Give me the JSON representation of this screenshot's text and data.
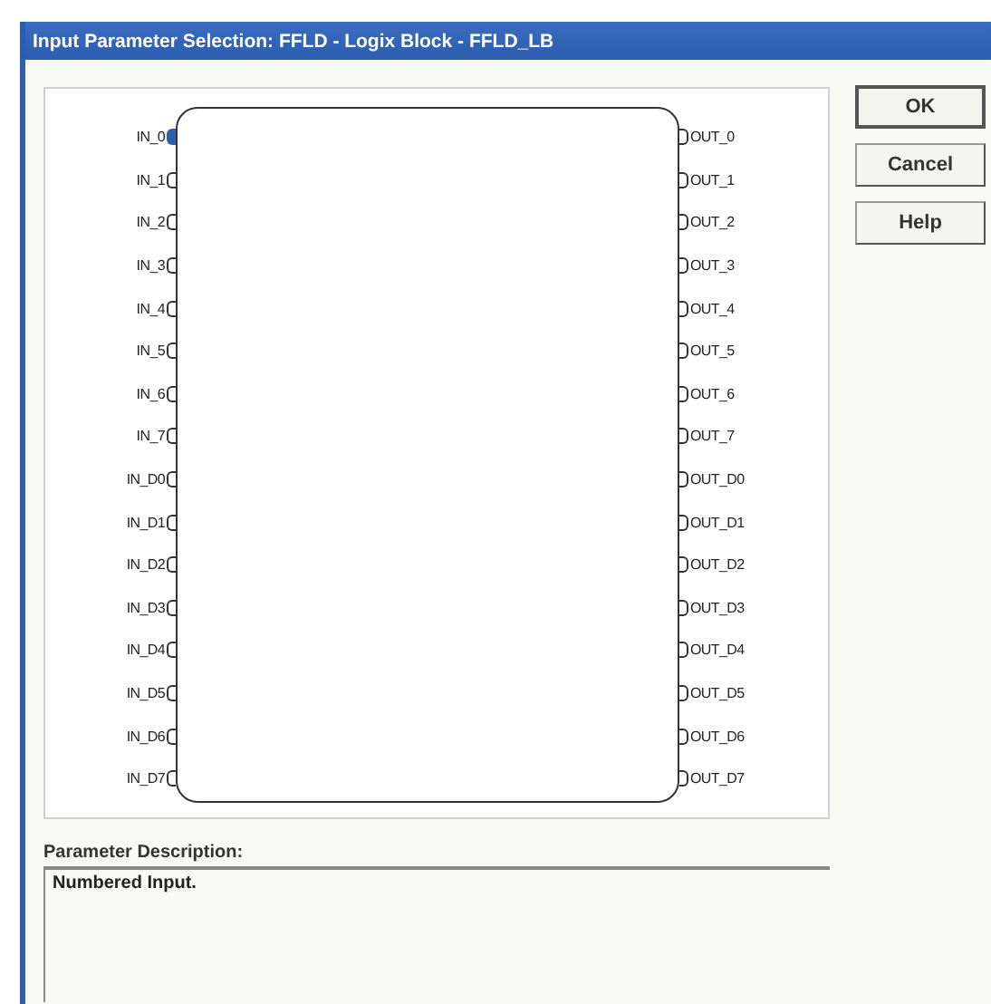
{
  "window": {
    "title": "Input Parameter Selection:  FFLD - Logix Block - FFLD_LB"
  },
  "inputs": [
    {
      "label": "IN_0",
      "selected": true
    },
    {
      "label": "IN_1",
      "selected": false
    },
    {
      "label": "IN_2",
      "selected": false
    },
    {
      "label": "IN_3",
      "selected": false
    },
    {
      "label": "IN_4",
      "selected": false
    },
    {
      "label": "IN_5",
      "selected": false
    },
    {
      "label": "IN_6",
      "selected": false
    },
    {
      "label": "IN_7",
      "selected": false
    },
    {
      "label": "IN_D0",
      "selected": false
    },
    {
      "label": "IN_D1",
      "selected": false
    },
    {
      "label": "IN_D2",
      "selected": false
    },
    {
      "label": "IN_D3",
      "selected": false
    },
    {
      "label": "IN_D4",
      "selected": false
    },
    {
      "label": "IN_D5",
      "selected": false
    },
    {
      "label": "IN_D6",
      "selected": false
    },
    {
      "label": "IN_D7",
      "selected": false
    }
  ],
  "outputs": [
    {
      "label": "OUT_0",
      "selected": false
    },
    {
      "label": "OUT_1",
      "selected": false
    },
    {
      "label": "OUT_2",
      "selected": false
    },
    {
      "label": "OUT_3",
      "selected": false
    },
    {
      "label": "OUT_4",
      "selected": false
    },
    {
      "label": "OUT_5",
      "selected": false
    },
    {
      "label": "OUT_6",
      "selected": false
    },
    {
      "label": "OUT_7",
      "selected": false
    },
    {
      "label": "OUT_D0",
      "selected": false
    },
    {
      "label": "OUT_D1",
      "selected": false
    },
    {
      "label": "OUT_D2",
      "selected": false
    },
    {
      "label": "OUT_D3",
      "selected": false
    },
    {
      "label": "OUT_D4",
      "selected": false
    },
    {
      "label": "OUT_D5",
      "selected": false
    },
    {
      "label": "OUT_D6",
      "selected": false
    },
    {
      "label": "OUT_D7",
      "selected": false
    }
  ],
  "buttons": [
    "OK",
    "Cancel",
    "Help"
  ],
  "description": {
    "label": "Parameter Description:",
    "text": "Numbered Input."
  }
}
